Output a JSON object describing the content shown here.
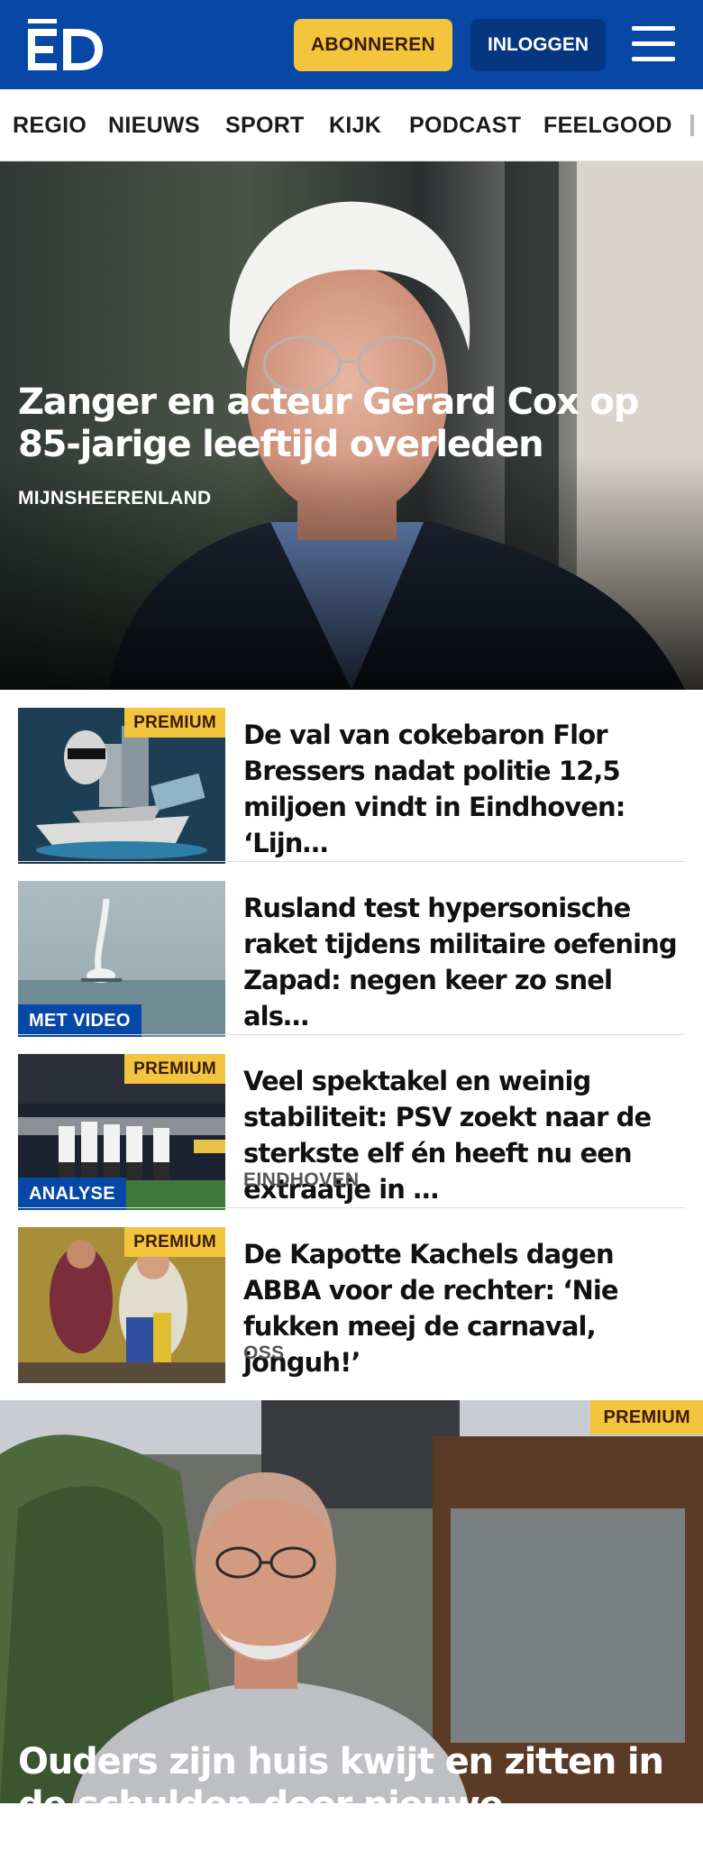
{
  "header": {
    "logo_text": "ED",
    "subscribe_label": "ABONNEREN",
    "login_label": "INLOGGEN",
    "menu_icon": "hamburger-menu-icon",
    "brand_color": "#0748a6",
    "accent_color": "#f3c53c"
  },
  "nav": {
    "items": [
      {
        "label": "REGIO"
      },
      {
        "label": "NIEUWS"
      },
      {
        "label": "SPORT"
      },
      {
        "label": "KIJK"
      },
      {
        "label": "PODCAST"
      },
      {
        "label": "FEELGOOD"
      }
    ]
  },
  "hero": {
    "title": "Zanger en acteur Gerard Cox op 85-jarige leeftijd overleden",
    "tag": "MIJNSHEERENLAND"
  },
  "stories": [
    {
      "title": "De val van cokebaron Flor Bressers nadat politie 12,5 miljoen vindt in Eindhoven: ‘Lijn…",
      "badge": "PREMIUM",
      "label": "",
      "location": ""
    },
    {
      "title": "Rusland test hypersonische raket tijdens militaire oefening Zapad: negen keer zo snel als…",
      "badge": "",
      "label": "MET VIDEO",
      "location": ""
    },
    {
      "title": "Veel spektakel en weinig stabili­teit: PSV zoekt naar de sterkste elf én heeft nu een extraatje in …",
      "badge": "PREMIUM",
      "label": "ANALYSE",
      "location": "EINDHOVEN"
    },
    {
      "title": "De Kapotte Kachels dagen ABBA voor de rechter: ‘Nie fukken meej de carnaval, jonguh!’",
      "badge": "PREMIUM",
      "label": "",
      "location": "OSS"
    }
  ],
  "hero2": {
    "badge": "PREMIUM",
    "title": "Ouders zijn huis kwijt en zitten in de schulden door nieuwe ‘vriendin’: ‘We…"
  }
}
